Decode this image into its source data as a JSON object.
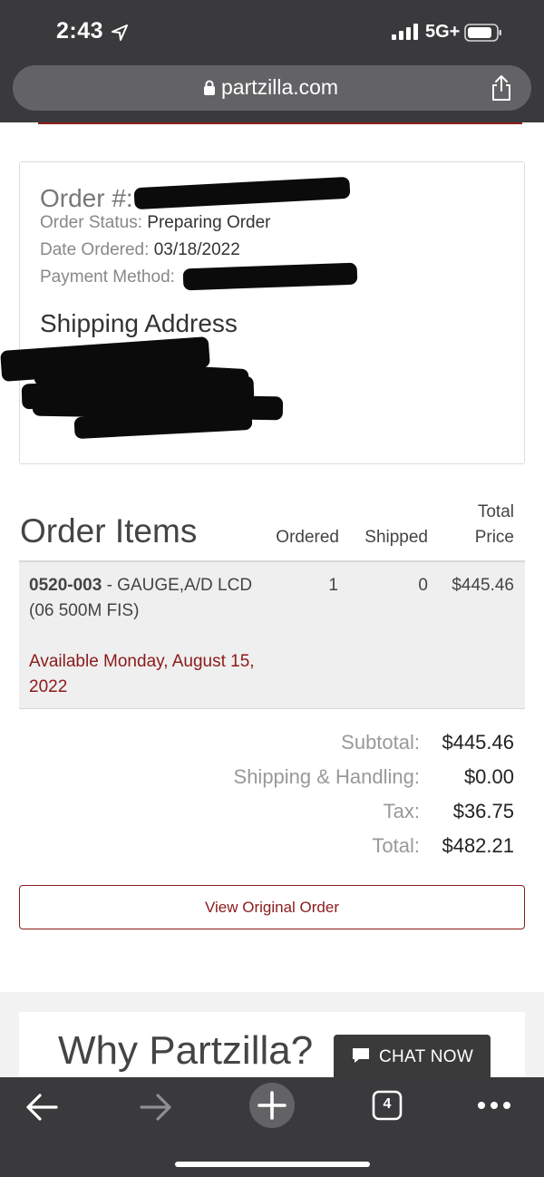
{
  "status_bar": {
    "time": "2:43",
    "network": "5G+"
  },
  "browser": {
    "url": "partzilla.com"
  },
  "order": {
    "number_label": "Order #:",
    "status_label": "Order Status:",
    "status_value": "Preparing Order",
    "date_label": "Date Ordered:",
    "date_value": "03/18/2022",
    "payment_label": "Payment Method:",
    "shipping_title": "Shipping Address"
  },
  "items": {
    "title": "Order Items",
    "columns": {
      "ordered": "Ordered",
      "shipped": "Shipped",
      "total_line1": "Total",
      "total_line2": "Price"
    },
    "rows": [
      {
        "part_number": "0520-003",
        "description": " - GAUGE,A/D LCD (06 500M FIS)",
        "availability": "Available Monday, August 15, 2022",
        "ordered": "1",
        "shipped": "0",
        "total": "$445.46"
      }
    ]
  },
  "totals": {
    "subtotal_label": "Subtotal:",
    "subtotal_value": "$445.46",
    "shipping_label": "Shipping & Handling:",
    "shipping_value": "$0.00",
    "tax_label": "Tax:",
    "tax_value": "$36.75",
    "total_label": "Total:",
    "total_value": "$482.21"
  },
  "actions": {
    "view_original": "View Original Order"
  },
  "promo": {
    "title": "Why Partzilla?",
    "chat_label": "CHAT NOW"
  },
  "toolbar": {
    "tab_count": "4"
  },
  "colors": {
    "brand_red": "#8b1a1a",
    "chrome_dark": "#3a3a3c"
  }
}
